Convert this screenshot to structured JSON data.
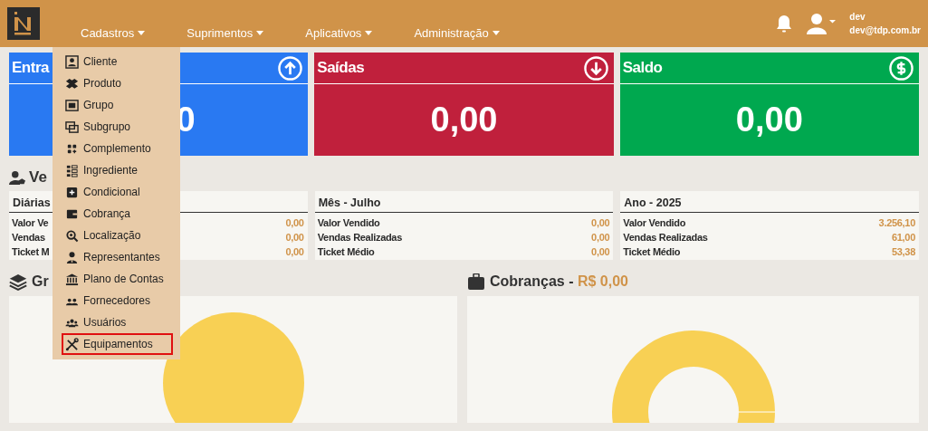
{
  "header": {
    "nav": [
      {
        "label": "Cadastros"
      },
      {
        "label": "Suprimentos"
      },
      {
        "label": "Aplicativos"
      },
      {
        "label": "Administração"
      }
    ],
    "user": {
      "name": "dev",
      "email": "dev@tdp.com.br"
    }
  },
  "menu": {
    "items": [
      {
        "label": "Cliente",
        "selected": false
      },
      {
        "label": "Produto",
        "selected": false
      },
      {
        "label": "Grupo",
        "selected": false
      },
      {
        "label": "Subgrupo",
        "selected": false
      },
      {
        "label": "Complemento",
        "selected": false
      },
      {
        "label": "Ingrediente",
        "selected": false
      },
      {
        "label": "Condicional",
        "selected": false
      },
      {
        "label": "Cobrança",
        "selected": false
      },
      {
        "label": "Localização",
        "selected": false
      },
      {
        "label": "Representantes",
        "selected": false
      },
      {
        "label": "Plano de Contas",
        "selected": false
      },
      {
        "label": "Fornecedores",
        "selected": false
      },
      {
        "label": "Usuários",
        "selected": false
      },
      {
        "label": "Equipamentos",
        "selected": true
      }
    ]
  },
  "cards": [
    {
      "title": "Entra",
      "value": "0",
      "kind": "up",
      "color": "#2979f2"
    },
    {
      "title": "Saídas",
      "value": "0,00",
      "kind": "down",
      "color": "#c0203c"
    },
    {
      "title": "Saldo",
      "value": "0,00",
      "kind": "money",
      "color": "#00a84f"
    }
  ],
  "sales": {
    "heading": "Ve",
    "panels": [
      {
        "title": "Diárias",
        "rows": [
          {
            "label": "Valor Ve",
            "value": "0,00"
          },
          {
            "label": "Vendas",
            "value": "0,00"
          },
          {
            "label": "Ticket M",
            "value": "0,00"
          }
        ]
      },
      {
        "title": "Mês - Julho",
        "rows": [
          {
            "label": "Valor Vendido",
            "value": "0,00"
          },
          {
            "label": "Vendas Realizadas",
            "value": "0,00"
          },
          {
            "label": "Ticket Médio",
            "value": "0,00"
          }
        ]
      },
      {
        "title": "Ano - 2025",
        "rows": [
          {
            "label": "Valor Vendido",
            "value": "3.256,10"
          },
          {
            "label": "Vendas Realizadas",
            "value": "61,00"
          },
          {
            "label": "Ticket Médio",
            "value": "53,38"
          }
        ]
      }
    ]
  },
  "charts": [
    {
      "heading": "Gr",
      "kind": "pie"
    },
    {
      "heading": "Cobranças - ",
      "amount": "R$ 0,00",
      "kind": "donut"
    }
  ]
}
